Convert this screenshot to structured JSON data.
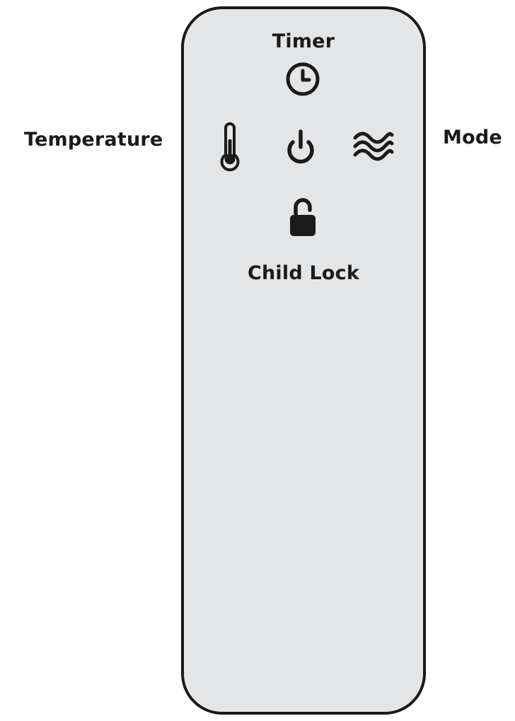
{
  "labels": {
    "timer": "Timer",
    "temperature": "Temperature",
    "mode": "Mode",
    "child_lock": "Child Lock"
  },
  "colors": {
    "remote_body": "#e4e5e7",
    "outline": "#1a1a1a",
    "background": "#ffffff"
  },
  "icons": {
    "timer": "clock-icon",
    "temperature": "thermometer-icon",
    "power": "power-icon",
    "mode": "waves-icon",
    "child_lock": "unlocked-padlock-icon"
  }
}
